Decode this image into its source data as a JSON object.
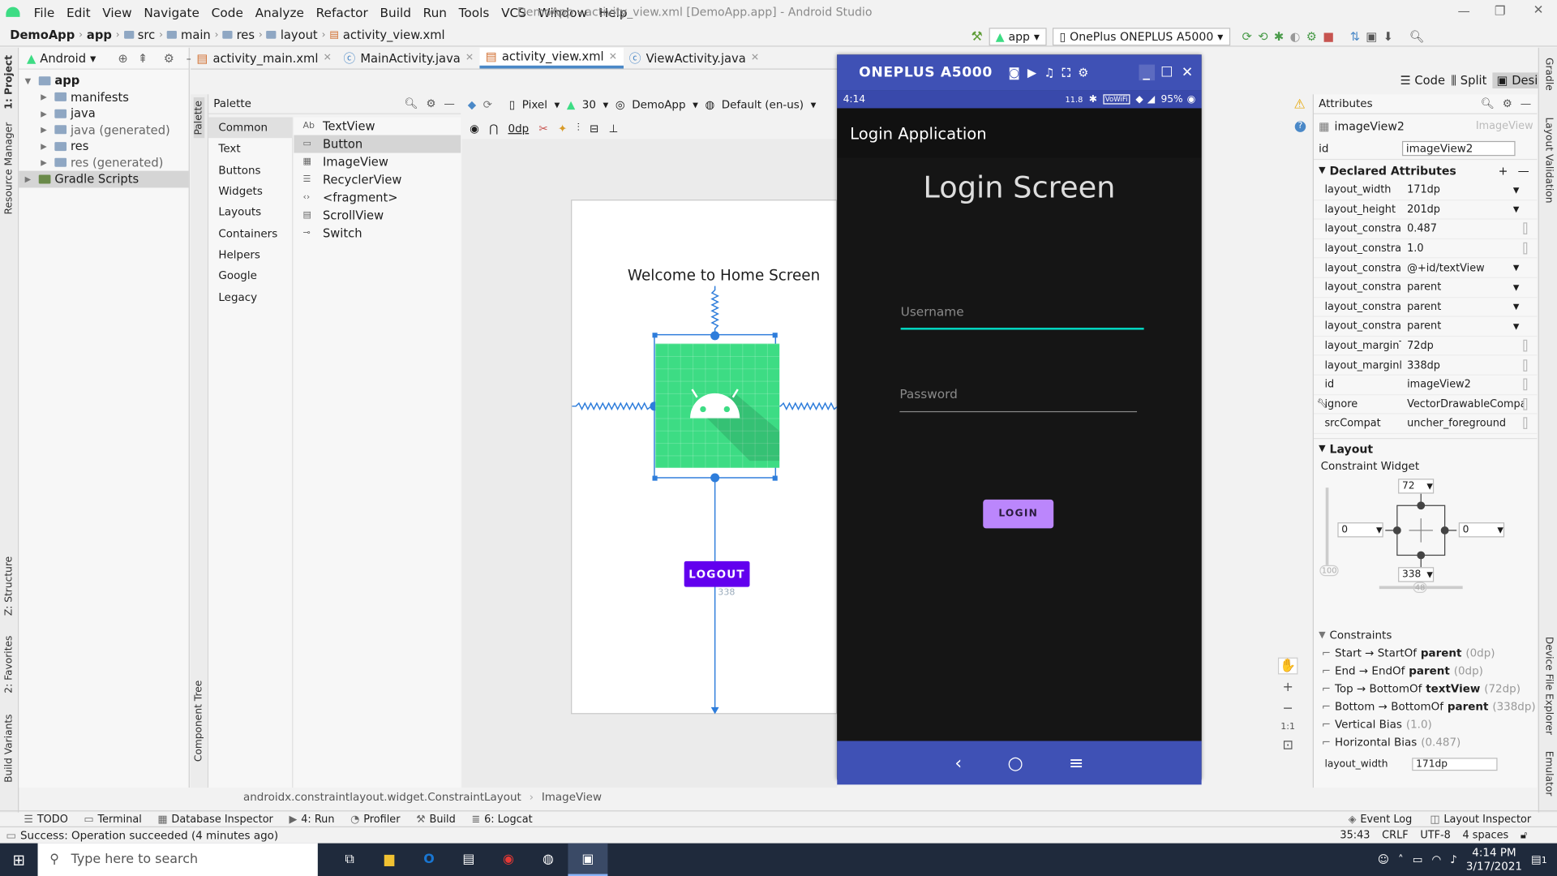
{
  "app": {
    "title": "DemoApp - activity_view.xml [DemoApp.app] - Android Studio"
  },
  "menu": [
    "File",
    "Edit",
    "View",
    "Navigate",
    "Code",
    "Analyze",
    "Refactor",
    "Build",
    "Run",
    "Tools",
    "VCS",
    "Window",
    "Help"
  ],
  "breadcrumb": [
    "DemoApp",
    "app",
    "src",
    "main",
    "res",
    "layout",
    "activity_view.xml"
  ],
  "toolbar": {
    "run_config": "app",
    "device": "OnePlus ONEPLUS A5000"
  },
  "project": {
    "view": "Android",
    "tree": [
      {
        "label": "app",
        "indent": 0,
        "bold": true
      },
      {
        "label": "manifests",
        "indent": 1
      },
      {
        "label": "java",
        "indent": 1
      },
      {
        "label": "java (generated)",
        "indent": 1
      },
      {
        "label": "res",
        "indent": 1
      },
      {
        "label": "res (generated)",
        "indent": 1
      },
      {
        "label": "Gradle Scripts",
        "indent": 0,
        "selected": true
      }
    ]
  },
  "left_tabs": {
    "project": "1: Project",
    "resource_manager": "Resource Manager",
    "structure": "Z: Structure",
    "favorites": "2: Favorites",
    "build_variants": "Build Variants"
  },
  "editor_tabs": [
    {
      "label": "activity_main.xml",
      "active": false
    },
    {
      "label": "MainActivity.java",
      "active": false
    },
    {
      "label": "activity_view.xml",
      "active": true
    },
    {
      "label": "ViewActivity.java",
      "active": false
    }
  ],
  "palette": {
    "title": "Palette",
    "categories": [
      "Common",
      "Text",
      "Buttons",
      "Widgets",
      "Layouts",
      "Containers",
      "Helpers",
      "Google",
      "Legacy"
    ],
    "items": [
      "TextView",
      "Button",
      "ImageView",
      "RecyclerView",
      "<fragment>",
      "ScrollView",
      "Switch"
    ],
    "tab_label": "Palette",
    "component_tree": "Component Tree"
  },
  "design_toolbar": {
    "device": "Pixel",
    "api": "30",
    "theme": "DemoApp",
    "locale": "Default (en-us)",
    "margin": "0dp"
  },
  "blueprint": {
    "welcome": "Welcome to Home Screen",
    "logout": "LOGOUT",
    "margin_label": "338"
  },
  "emulator": {
    "title": "ONEPLUS A5000",
    "time": "4:14",
    "battery": "95%",
    "net_speed": "11.8",
    "action_title": "Login Application",
    "heading": "Login Screen",
    "username_hint": "Username",
    "password_hint": "Password",
    "login_button": "LOGIN"
  },
  "view_modes": [
    "Code",
    "Split",
    "Design"
  ],
  "attributes": {
    "title": "Attributes",
    "widget_type": "imageView2",
    "widget_kind": "ImageView",
    "id_label": "id",
    "id_value": "imageView2",
    "declared_header": "Declared Attributes",
    "rows": [
      {
        "k": "layout_width",
        "v": "171dp"
      },
      {
        "k": "layout_height",
        "v": "201dp"
      },
      {
        "k": "layout_constrai...",
        "v": "0.487"
      },
      {
        "k": "layout_constrai...",
        "v": "1.0"
      },
      {
        "k": "layout_constrai...",
        "v": "@+id/textView"
      },
      {
        "k": "layout_constrai...",
        "v": "parent"
      },
      {
        "k": "layout_constrai...",
        "v": "parent"
      },
      {
        "k": "layout_constrai...",
        "v": "parent"
      },
      {
        "k": "layout_marginT...",
        "v": "72dp"
      },
      {
        "k": "layout_marginB...",
        "v": "338dp"
      },
      {
        "k": "id",
        "v": "imageView2"
      },
      {
        "k": "ignore",
        "v": "VectorDrawableCompa"
      },
      {
        "k": "srcCompat",
        "v": "uncher_foreground"
      }
    ],
    "layout_header": "Layout",
    "constraint_widget": "Constraint Widget",
    "margin_top": "72",
    "margin_bottom": "338",
    "margin_left": "0",
    "margin_right": "0",
    "bias_v": "100",
    "bias_h": "48",
    "constraints_header": "Constraints",
    "constraints": [
      {
        "a": "Start → StartOf ",
        "b": "parent",
        "c": " (0dp)"
      },
      {
        "a": "End → EndOf ",
        "b": "parent",
        "c": " (0dp)"
      },
      {
        "a": "Top → BottomOf ",
        "b": "textView",
        "c": " (72dp)"
      },
      {
        "a": "Bottom → BottomOf ",
        "b": "parent",
        "c": " (338dp)"
      },
      {
        "a": "Vertical Bias ",
        "b": "",
        "c": "(1.0)"
      },
      {
        "a": "Horizontal Bias ",
        "b": "",
        "c": "(0.487)"
      }
    ],
    "layout_width_row": "layout_width",
    "layout_width_val": "171dp"
  },
  "right_tabs": {
    "gradle": "Gradle",
    "layout_validation": "Layout Validation",
    "device_file_explorer": "Device File Explorer",
    "emulator": "Emulator"
  },
  "path_bar": [
    "androidx.constraintlayout.widget.ConstraintLayout",
    "ImageView"
  ],
  "bottom_tools": [
    "TODO",
    "Terminal",
    "Database Inspector",
    "4: Run",
    "Profiler",
    "Build",
    "6: Logcat"
  ],
  "bottom_tools_right": [
    "Event Log",
    "Layout Inspector"
  ],
  "status": {
    "message": "Success: Operation succeeded (4 minutes ago)",
    "position": "35:43",
    "line_sep": "CRLF",
    "encoding": "UTF-8",
    "indent": "4 spaces"
  },
  "taskbar": {
    "search": "Type here to search",
    "time": "4:14 PM",
    "date": "3/17/2021",
    "notif": "1"
  },
  "colors": {
    "accent": "#4a88c7",
    "android_green": "#3ddc84",
    "purple": "#6200ee",
    "emu_bar": "#3f51b5",
    "login_btn": "#bb86fc",
    "teal": "#03dac5"
  }
}
